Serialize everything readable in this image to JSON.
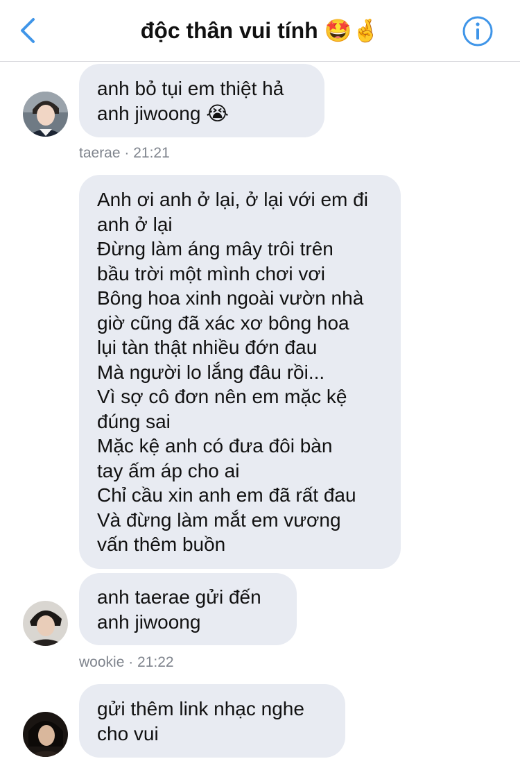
{
  "header": {
    "title": "độc thân vui tính 🤩🤞",
    "back_icon": "chevron-left-icon",
    "info_icon": "info-circle-icon",
    "accent_color": "#3f95e8"
  },
  "messages": [
    {
      "lines": [
        "anh bỏ tụi em thiệt hả",
        "anh jiwoong 😭"
      ]
    },
    {
      "sender": "taerae",
      "time": "21:21"
    },
    {
      "lines": [
        "Anh ơi anh ở lại, ở lại với em đi",
        "anh ở lại",
        "Đừng làm áng mây trôi trên",
        "bầu trời một mình chơi vơi",
        "Bông hoa xinh ngoài vườn nhà",
        "giờ cũng đã xác xơ bông hoa",
        "lụi tàn thật nhiều đớn đau",
        "Mà người lo lắng đâu rồi...",
        "Vì sợ cô đơn nên em mặc kệ",
        "đúng sai",
        "Mặc kệ anh có đưa đôi bàn",
        "tay ấm áp cho ai",
        "Chỉ cầu xin anh em đã rất đau",
        "Và đừng làm mắt em vương",
        "vấn thêm buồn"
      ]
    },
    {
      "lines": [
        "anh taerae gửi đến",
        "anh jiwoong"
      ]
    },
    {
      "sender": "wookie",
      "time": "21:22"
    },
    {
      "lines": [
        "gửi thêm link nhạc nghe",
        "cho vui"
      ]
    }
  ],
  "meta_separator": " · ",
  "bubble_color": "#e8ebf2"
}
